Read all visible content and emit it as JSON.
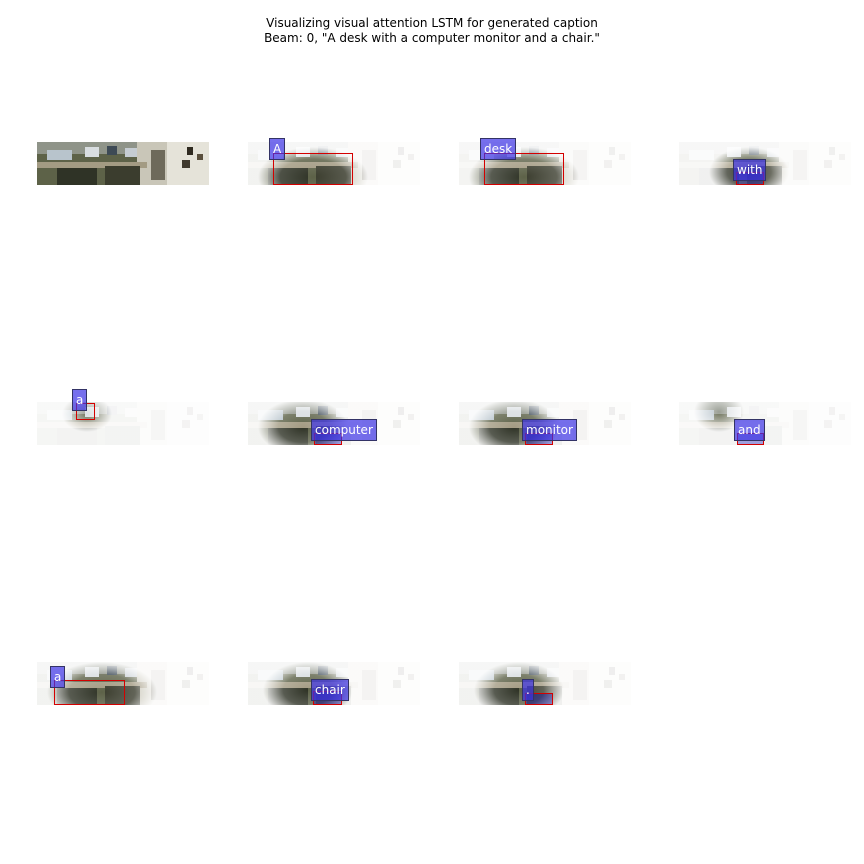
{
  "title_line1": "Visualizing visual attention LSTM for generated caption",
  "title_line2": "Beam: 0, \"A desk with a computer monitor and a chair.\"",
  "words": [
    "A",
    "desk",
    "with",
    "a",
    "computer",
    "monitor",
    "and",
    "a",
    "chair",
    "."
  ],
  "colors": {
    "label_bg": "#4b3cf0",
    "box": "#d40000"
  }
}
